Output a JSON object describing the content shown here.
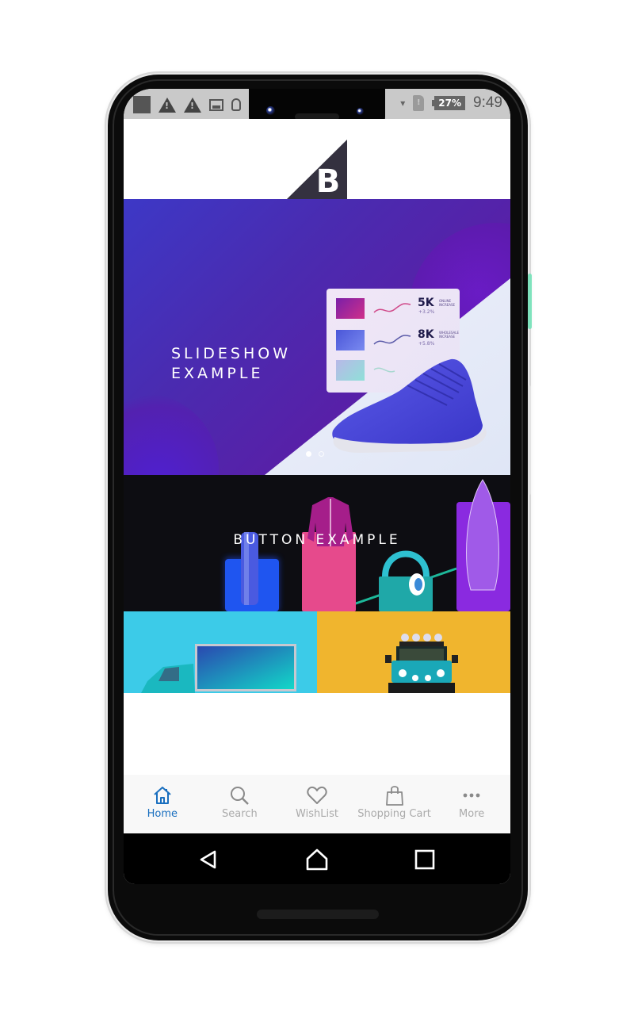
{
  "status_bar": {
    "left_icons": [
      "notification-square-icon",
      "warning-icon",
      "warning-icon",
      "image-icon",
      "bulb-icon"
    ],
    "right_icons": [
      "signal-icon",
      "sim-alert-icon",
      "battery-icon"
    ],
    "battery": "27%",
    "time": "9:49"
  },
  "logo": {
    "letter": "B",
    "color": "#34313f"
  },
  "slideshow": {
    "title_line1": "SLIDESHOW",
    "title_line2": "EXAMPLE",
    "card": {
      "rows": [
        {
          "value": "5K",
          "label": "ONLINE INCREASE",
          "change": "+3.2%",
          "thumb_color": "#c72a8a"
        },
        {
          "value": "8K",
          "label": "WHOLESALE INCREASE",
          "change": "+5.8%",
          "thumb_color": "#5a6ae0"
        },
        {
          "value": "",
          "label": "",
          "change": "",
          "thumb_color": "#8fe0d8"
        }
      ]
    },
    "pagination": {
      "current": 1,
      "total": 2
    }
  },
  "button_banner": {
    "title": "BUTTON EXAMPLE"
  },
  "tiles": [
    {
      "name": "truck",
      "bg": "#3ccbe8"
    },
    {
      "name": "jeep",
      "bg": "#f0b52e"
    }
  ],
  "tabbar": {
    "active_color": "#1a6fbf",
    "inactive_color": "#aaaaaa",
    "items": [
      {
        "label": "Home",
        "icon": "home-icon",
        "active": true
      },
      {
        "label": "Search",
        "icon": "search-icon",
        "active": false
      },
      {
        "label": "WishList",
        "icon": "heart-icon",
        "active": false
      },
      {
        "label": "Shopping Cart",
        "icon": "shopping-bag-icon",
        "active": false
      },
      {
        "label": "More",
        "icon": "more-dots-icon",
        "active": false
      }
    ]
  },
  "nav_bar": {
    "buttons": [
      "back-icon",
      "home-icon",
      "recents-icon"
    ]
  }
}
